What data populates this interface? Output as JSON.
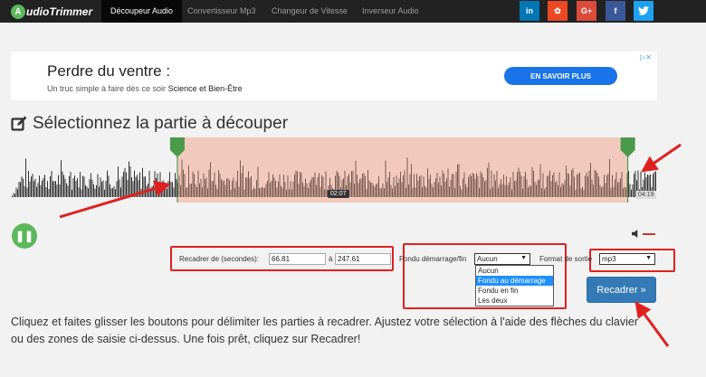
{
  "nav": {
    "logo_letter": "A",
    "logo_text": "udioTrimmer",
    "links": [
      "Découpeur Audio",
      "Convertisseur Mp3",
      "Changeur de Vitesse",
      "Inverseur Audio"
    ],
    "social": [
      {
        "label": "in",
        "color": "#0077b5",
        "icon": "linkedin-icon"
      },
      {
        "label": "✿",
        "color": "#eb4924",
        "icon": "stumbleupon-icon"
      },
      {
        "label": "G+",
        "color": "#dd4b39",
        "icon": "google-plus-icon"
      },
      {
        "label": "f",
        "color": "#3b5998",
        "icon": "facebook-icon"
      },
      {
        "label": "🐦",
        "color": "#1da1f2",
        "icon": "twitter-icon"
      }
    ]
  },
  "ad": {
    "title": "Perdre du ventre :",
    "subtitle_prefix": "Un truc simple à faire dès ce soir ",
    "subtitle_bold": "Science et Bien-Être",
    "button": "EN SAVOIR PLUS",
    "choices": "▷✕"
  },
  "heading": "Sélectionnez la partie à découper",
  "player": {
    "current_time": "02:07",
    "end_time": "04:19",
    "play_icon": "pause-icon",
    "selection_start_fraction": 0.258,
    "selection_end_fraction": 0.956
  },
  "controls": {
    "recadrer_label": "Recadrer de (secondes):",
    "start_value": "66.81",
    "to_label": "à",
    "end_value": "247.61",
    "fade_label": "Fondu démarrage/fin",
    "fade_value": "Aucun",
    "fade_options": [
      "Aucun",
      "Fondu au démarrage",
      "Fondu en fin",
      "Les deux"
    ],
    "fade_highlighted": 1,
    "format_label": "Format de sortie",
    "format_value": "mp3",
    "submit": "Recadrer »"
  },
  "instructions": "Cliquez et faites glisser les boutons pour délimiter les parties à recadrer. Ajustez votre sélection à l'aide des flèches du clavier ou des zones de saisie ci-dessus. Une fois prêt, cliquez sur Recadrer!",
  "colors": {
    "accent_green": "#5cb85c",
    "selection": "#f2c9bd",
    "annotation_red": "#e02020",
    "button_blue": "#337ab7"
  }
}
